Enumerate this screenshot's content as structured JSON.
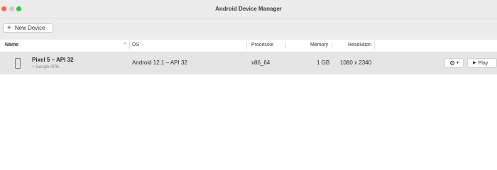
{
  "window": {
    "title": "Android Device Manager"
  },
  "toolbar": {
    "new_device_icon": "+",
    "new_device_label": "New Device"
  },
  "table": {
    "columns": {
      "name": "Name",
      "os": "OS",
      "processor": "Processor",
      "memory": "Memory",
      "resolution": "Resolution"
    },
    "sort_indicator": "^",
    "rows": [
      {
        "name": "Pixel 5 – API 32",
        "subtitle": "+ Google APIs",
        "os": "Android 12.1 – API 32",
        "processor": "x86_64",
        "memory": "1 GB",
        "resolution": "1080 x 2340",
        "play_label": "Play"
      }
    ]
  },
  "colors": {
    "close": "#ff5f57",
    "minimize": "#c9c9c9",
    "zoom": "#28c840",
    "selected_row": "#e5e5e5"
  },
  "icons": {
    "add": "plus-icon",
    "device": "phone-icon",
    "settings": "gear-icon",
    "dropdown": "chevron-down-icon",
    "play": "play-icon"
  }
}
